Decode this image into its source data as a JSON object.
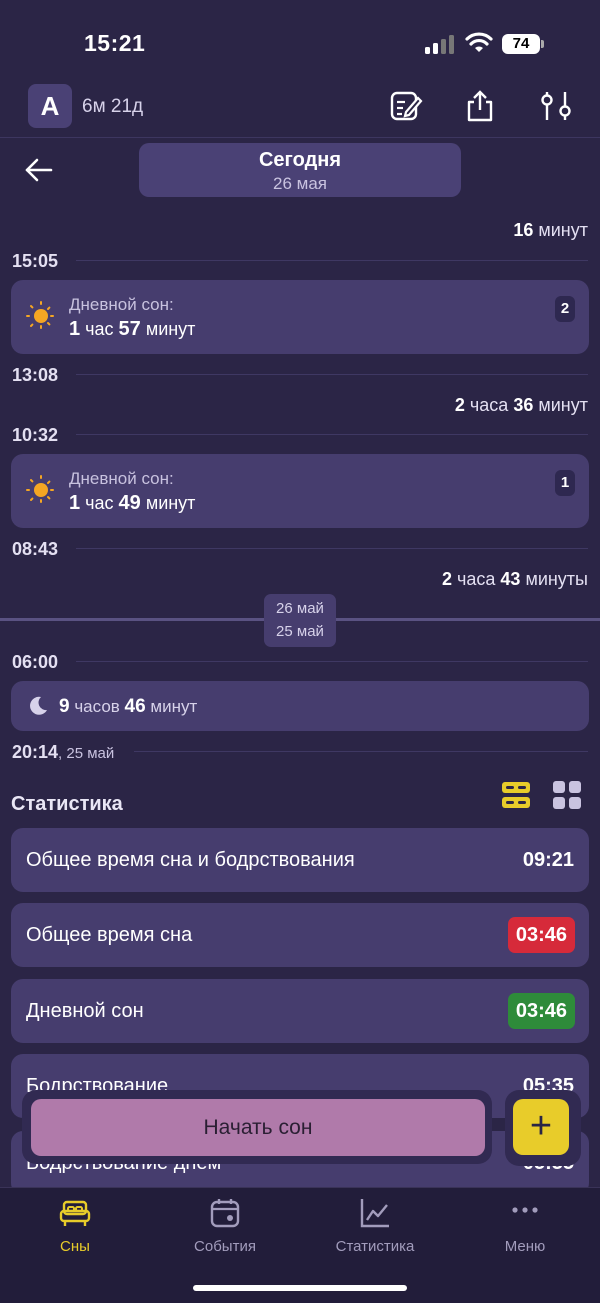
{
  "status_bar": {
    "time": "15:21",
    "battery": "74"
  },
  "header": {
    "avatar_letter": "A",
    "age": "6м 21д"
  },
  "date_nav": {
    "title": "Сегодня",
    "date": "26 мая"
  },
  "timeline": {
    "awake_1": {
      "num": "16",
      "unit": "минут"
    },
    "t_1505": "15:05",
    "nap_2": {
      "label": "Дневной сон:",
      "h": "1",
      "h_unit": "час",
      "m": "57",
      "m_unit": "минут",
      "badge": "2"
    },
    "t_1308": "13:08",
    "awake_2": {
      "h": "2",
      "h_unit": "часа",
      "m": "36",
      "m_unit": "минут"
    },
    "t_1032": "10:32",
    "nap_1": {
      "label": "Дневной сон:",
      "h": "1",
      "h_unit": "час",
      "m": "49",
      "m_unit": "минут",
      "badge": "1"
    },
    "t_0843": "08:43",
    "awake_3": {
      "h": "2",
      "h_unit": "часа",
      "m": "43",
      "m_unit": "минуты"
    },
    "day_chip_top": "26 май",
    "day_chip_bottom": "25 май",
    "t_0600": "06:00",
    "night": {
      "h": "9",
      "h_unit": "часов",
      "m": "46",
      "m_unit": "минут"
    },
    "t_2014": "20:14",
    "t_2014_date": ", 25 май"
  },
  "stats": {
    "title": "Статистика",
    "rows": [
      {
        "name": "Общее время сна и бодрствования",
        "value": "09:21"
      },
      {
        "name": "Общее время сна",
        "value": "03:46",
        "color": "#d62a3a"
      },
      {
        "name": "Дневной сон",
        "value": "03:46",
        "color": "#2e8b3a"
      },
      {
        "name": "Бодрствование",
        "value": "05:35"
      },
      {
        "name": "Бодрствование днем",
        "value": "05:35"
      }
    ]
  },
  "actions": {
    "start_sleep": "Начать сон",
    "add": "+"
  },
  "tabs": [
    {
      "label": "Сны",
      "icon": "bed-icon",
      "active": true
    },
    {
      "label": "События",
      "icon": "calendar-icon"
    },
    {
      "label": "Статистика",
      "icon": "chart-icon"
    },
    {
      "label": "Меню",
      "icon": "more-icon"
    }
  ],
  "colors": {
    "accent": "#e8cc2a",
    "background": "#2b2546",
    "card": "#463d6e",
    "start_button": "#b07aaa"
  }
}
